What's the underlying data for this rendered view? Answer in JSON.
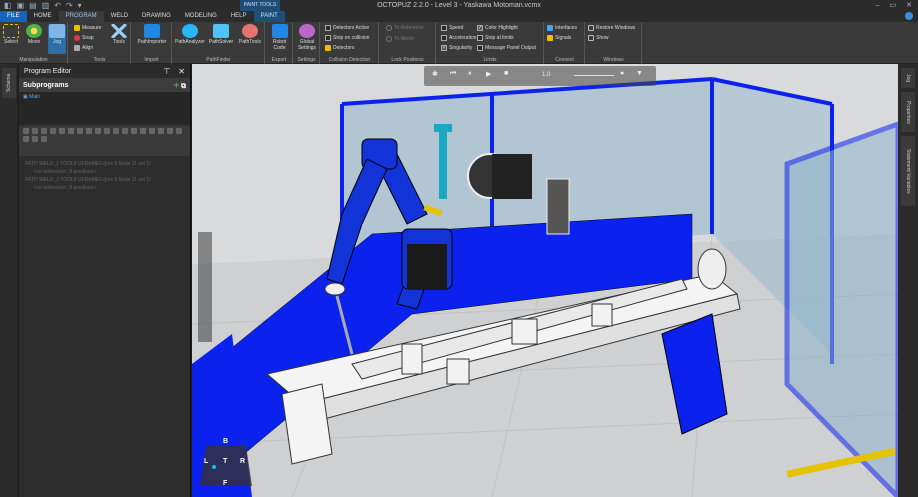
{
  "window": {
    "title": "OCTOPUZ 2.2.0 - Level 3 - Yaskawa Motoman.vcmx",
    "context_tab": "PAINT TOOLS",
    "controls": [
      "–",
      "▭",
      "✕"
    ]
  },
  "tabs": [
    "FILE",
    "HOME",
    "PROGRAM",
    "WELD",
    "DRAWING",
    "MODELING",
    "HELP",
    "PAINT"
  ],
  "ribbon": {
    "manipulation": {
      "label": "Manipulation",
      "select": "Select",
      "move": "Move",
      "jog": "Jog"
    },
    "tools": {
      "label": "Tools",
      "measure": "Measure",
      "snap": "Snap",
      "align": "Align",
      "tools": "Tools"
    },
    "import": {
      "label": "Import",
      "pathimporter": "PathImporter"
    },
    "pathfinder": {
      "label": "PathFinder",
      "analyzer": "PathAnalyzer",
      "solver": "PathSolver",
      "pathtools": "PathTools"
    },
    "export": {
      "label": "Export",
      "robot_code": "Robot Code"
    },
    "settings": {
      "label": "Settings",
      "global": "Global Settings"
    },
    "collision": {
      "label": "Collision Detection",
      "detectors_active": "Detectors Active",
      "stop_on_collision": "Stop on collision",
      "detectors": "Detectors"
    },
    "lock": {
      "label": "Lock Positions",
      "to_reference": "To Reference",
      "to_world": "To World"
    },
    "limits": {
      "label": "Limits",
      "speed": "Speed",
      "acceleration": "Acceleration",
      "singularity": "Singularity",
      "color_highlight": "Color Highlight",
      "stop_at_limits": "Stop at limits",
      "message_panel_output": "Message Panel Output"
    },
    "connect": {
      "label": "Connect",
      "interfaces": "Interfaces",
      "signals": "Signals"
    },
    "windows": {
      "label": "Windows",
      "restore": "Restore Windows",
      "show": "Show"
    }
  },
  "left_tab": "Schema",
  "program_editor": {
    "title": "Program Editor",
    "subprograms": "Subprograms",
    "main": "Main",
    "statements": [
      {
        "text": "PATH WELD_1 TOOL0 UFRAME0 (pos 8 fields 11 ext 1)",
        "indent": false
      },
      {
        "text": "<no references, 8 positions>",
        "indent": true
      },
      {
        "text": "PATH WELD_2 TOOL0 UFRAME0 (pos 8 fields 11 ext 1)",
        "indent": false
      },
      {
        "text": "<no references, 8 positions>",
        "indent": true
      }
    ]
  },
  "right_tabs": [
    "Jog",
    "Properties",
    "Statement Variables"
  ],
  "viewport": {
    "toolbar_value": "1.0",
    "cube": {
      "top": "B",
      "left": "L",
      "center": "T",
      "right": "R",
      "bottom": "F"
    }
  },
  "colors": {
    "accent": "#1565c0",
    "robot": "#1133d8",
    "cell": "#0b22ee"
  }
}
